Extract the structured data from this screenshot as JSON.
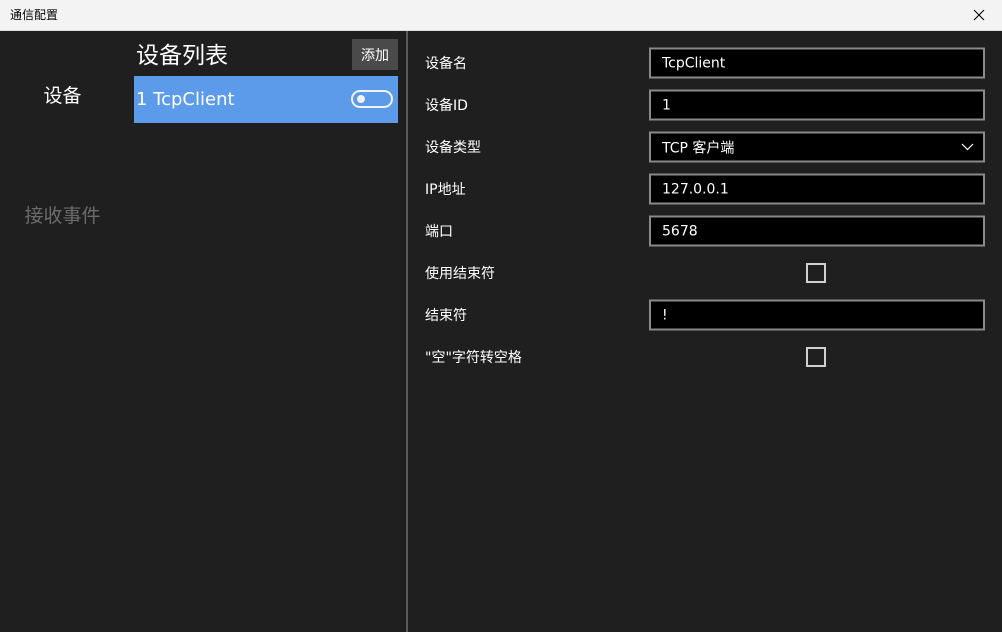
{
  "window": {
    "title": "通信配置"
  },
  "nav": {
    "items": [
      {
        "label": "设备"
      },
      {
        "label": "接收事件"
      }
    ]
  },
  "device_list": {
    "title": "设备列表",
    "add_label": "添加",
    "items": [
      {
        "label": "1 TcpClient",
        "enabled": false
      }
    ]
  },
  "form": {
    "device_name": {
      "label": "设备名",
      "value": "TcpClient"
    },
    "device_id": {
      "label": "设备ID",
      "value": "1"
    },
    "device_type": {
      "label": "设备类型",
      "value": "TCP 客户端"
    },
    "ip_address": {
      "label": "IP地址",
      "value": "127.0.0.1"
    },
    "port": {
      "label": "端口",
      "value": "5678"
    },
    "use_terminator": {
      "label": "使用结束符",
      "checked": false
    },
    "terminator": {
      "label": "结束符",
      "value": "!"
    },
    "null_to_space": {
      "label": "\"空\"字符转空格",
      "checked": false
    }
  },
  "colors": {
    "background": "#1f1f1f",
    "selected_item": "#5b9bea",
    "field_bg": "#000000",
    "field_border": "#8a8a8a",
    "titlebar": "#f3f3f3"
  },
  "icons": {
    "close": "close-icon",
    "dropdown": "chevron-down-icon"
  }
}
